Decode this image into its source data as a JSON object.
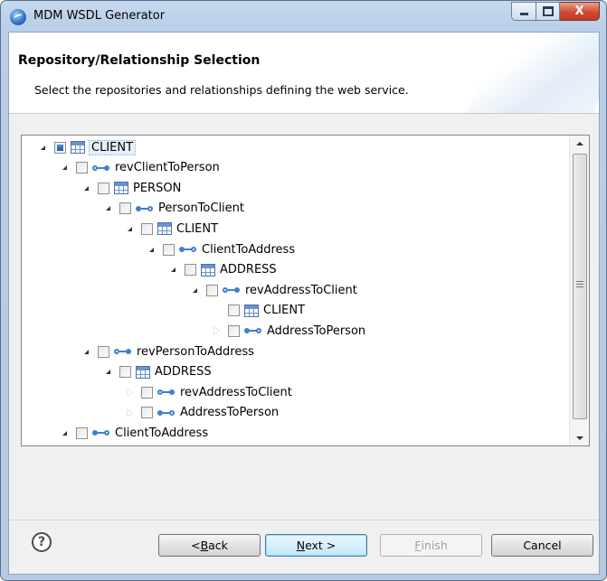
{
  "window": {
    "title": "MDM WSDL Generator",
    "icons": {
      "app": "mdm-app-icon",
      "minimize": "minimize-icon",
      "maximize": "maximize-icon",
      "close": "close-icon"
    },
    "close_glyph": "X"
  },
  "header": {
    "title": "Repository/Relationship Selection",
    "description": "Select the repositories and relationships defining the web service."
  },
  "tree": {
    "rows": [
      {
        "label": "CLIENT",
        "type": "table",
        "expander": "open",
        "check": "partial",
        "selected": true
      },
      {
        "label": "revClientToPerson",
        "type": "rel-rev",
        "expander": "open",
        "check": "unchecked"
      },
      {
        "label": "PERSON",
        "type": "table",
        "expander": "open",
        "check": "unchecked"
      },
      {
        "label": "PersonToClient",
        "type": "rel-fwd",
        "expander": "open",
        "check": "unchecked"
      },
      {
        "label": "CLIENT",
        "type": "table",
        "expander": "open",
        "check": "unchecked"
      },
      {
        "label": "ClientToAddress",
        "type": "rel-fwd",
        "expander": "open",
        "check": "unchecked"
      },
      {
        "label": "ADDRESS",
        "type": "table",
        "expander": "open",
        "check": "unchecked"
      },
      {
        "label": "revAddressToClient",
        "type": "rel-rev",
        "expander": "open",
        "check": "unchecked"
      },
      {
        "label": "CLIENT",
        "type": "table",
        "expander": "none",
        "check": "unchecked"
      },
      {
        "label": "AddressToPerson",
        "type": "rel-fwd",
        "expander": "closed",
        "check": "unchecked"
      },
      {
        "label": "revPersonToAddress",
        "type": "rel-rev",
        "expander": "open",
        "check": "unchecked"
      },
      {
        "label": "ADDRESS",
        "type": "table",
        "expander": "open",
        "check": "unchecked"
      },
      {
        "label": "revAddressToClient",
        "type": "rel-rev",
        "expander": "closed",
        "check": "unchecked"
      },
      {
        "label": "AddressToPerson",
        "type": "rel-fwd",
        "expander": "closed",
        "check": "unchecked"
      },
      {
        "label": "ClientToAddress",
        "type": "rel-fwd",
        "expander": "open",
        "check": "unchecked"
      }
    ],
    "scrollbar_position": 0.0
  },
  "footer": {
    "help_glyph": "?",
    "back": {
      "mnemonic": "B",
      "rest": "ack",
      "prefix": "< "
    },
    "next": {
      "mnemonic": "N",
      "rest": "ext >"
    },
    "finish": {
      "mnemonic": "F",
      "rest": "inish"
    },
    "cancel": "Cancel"
  }
}
